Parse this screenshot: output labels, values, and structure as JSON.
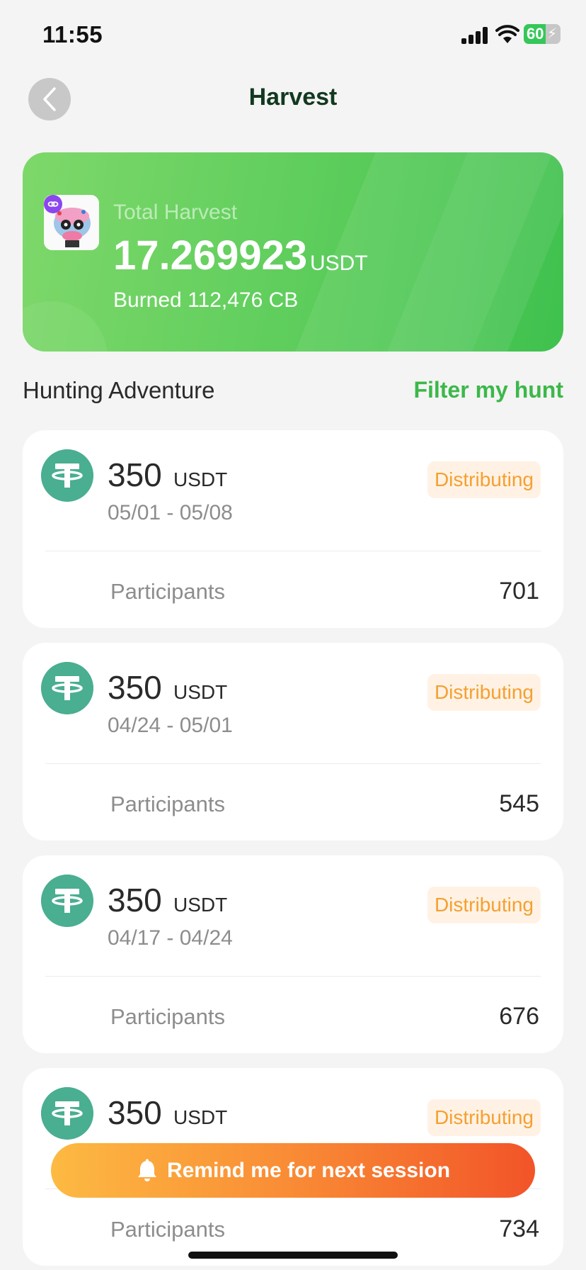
{
  "status_bar": {
    "time": "11:55",
    "battery": "60",
    "battery_level": 0.6
  },
  "header": {
    "title": "Harvest"
  },
  "summary": {
    "label": "Total Harvest",
    "amount": "17.269923",
    "unit": "USDT",
    "burned": "Burned 112,476 CB"
  },
  "section": {
    "title": "Hunting Adventure",
    "filter_label": "Filter my hunt"
  },
  "hunts": [
    {
      "amount": "350",
      "unit": "USDT",
      "dates": "05/01 - 05/08",
      "status": "Distributing",
      "participants_label": "Participants",
      "participants": "701"
    },
    {
      "amount": "350",
      "unit": "USDT",
      "dates": "04/24 - 05/01",
      "status": "Distributing",
      "participants_label": "Participants",
      "participants": "545"
    },
    {
      "amount": "350",
      "unit": "USDT",
      "dates": "04/17 - 04/24",
      "status": "Distributing",
      "participants_label": "Participants",
      "participants": "676"
    },
    {
      "amount": "350",
      "unit": "USDT",
      "dates": "",
      "status": "Distributing",
      "participants_label": "Participants",
      "participants": "734"
    }
  ],
  "remind_button": {
    "label": "Remind me for next session"
  },
  "colors": {
    "accent": "#3cb84a",
    "status": "#f5a030",
    "token": "#4aae91"
  }
}
